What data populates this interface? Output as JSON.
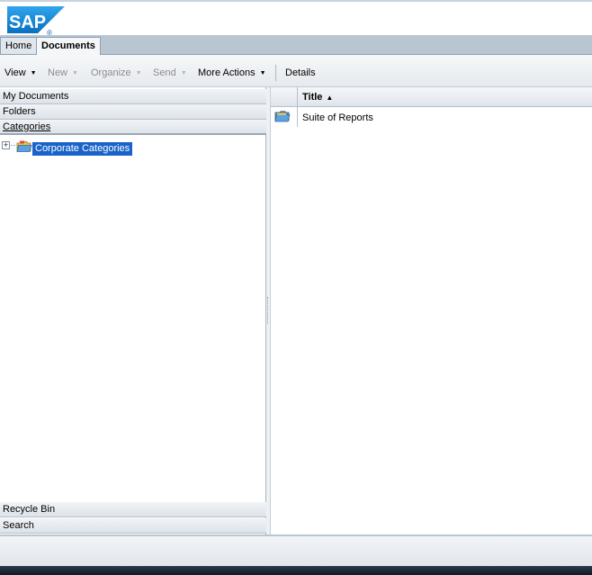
{
  "header": {
    "logo_text": "SAP",
    "logo_mark": "®"
  },
  "tabs": [
    {
      "label": "Home",
      "active": false
    },
    {
      "label": "Documents",
      "active": true
    }
  ],
  "toolbar": {
    "view": "View",
    "new": "New",
    "organize": "Organize",
    "send": "Send",
    "more_actions": "More Actions",
    "details": "Details"
  },
  "left_panel": {
    "sections_top": [
      "My Documents",
      "Folders",
      "Categories"
    ],
    "tree": {
      "expander": "+",
      "label": "Corporate Categories",
      "selected": true
    },
    "sections_bottom": [
      "Recycle Bin",
      "Search"
    ]
  },
  "list": {
    "column_title": "Title",
    "sort": "ascending",
    "rows": [
      {
        "title": "Suite of Reports",
        "icon": "folder-icon"
      }
    ]
  },
  "colors": {
    "selection": "#1a63c9",
    "tab_bar": "#b9c6d2",
    "logo_blue": "#0a7ac8"
  }
}
